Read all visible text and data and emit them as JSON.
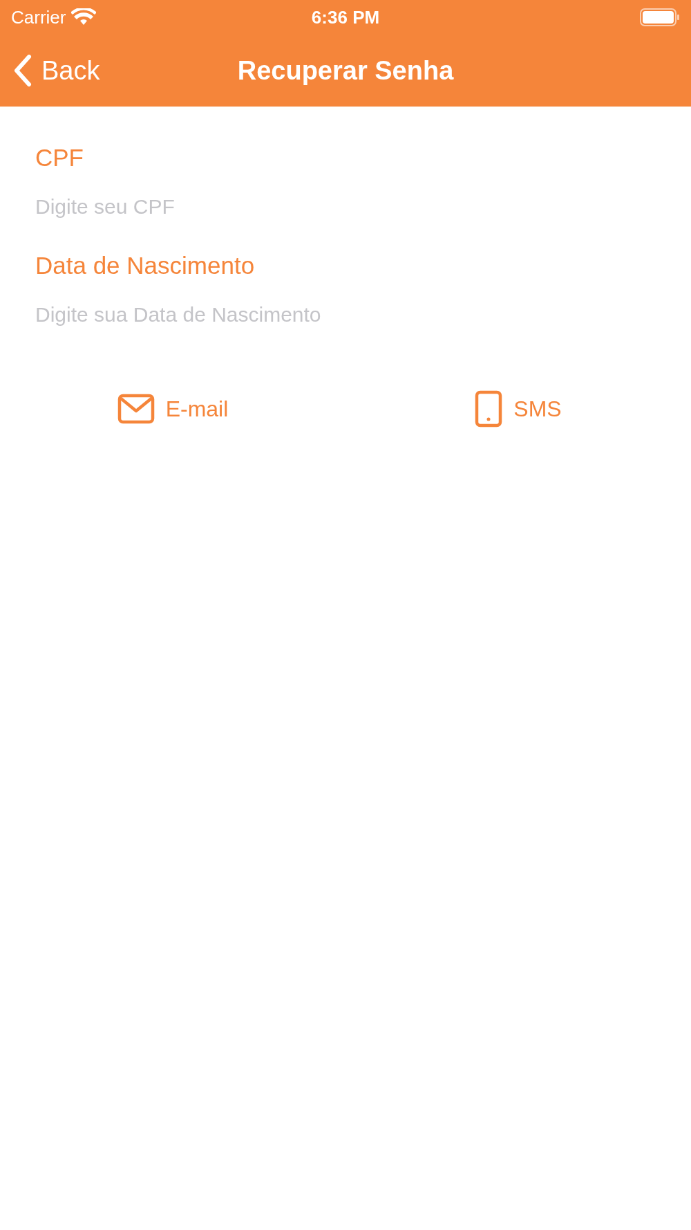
{
  "status_bar": {
    "carrier": "Carrier",
    "time": "6:36 PM"
  },
  "nav": {
    "back": "Back",
    "title": "Recuperar Senha"
  },
  "fields": [
    {
      "label": "CPF",
      "placeholder": "Digite seu CPF"
    },
    {
      "label": "Data de Nascimento",
      "placeholder": "Digite sua Data de Nascimento"
    }
  ],
  "buttons": [
    {
      "kind": "email",
      "label": "E-mail"
    },
    {
      "kind": "sms",
      "label": "SMS"
    }
  ]
}
